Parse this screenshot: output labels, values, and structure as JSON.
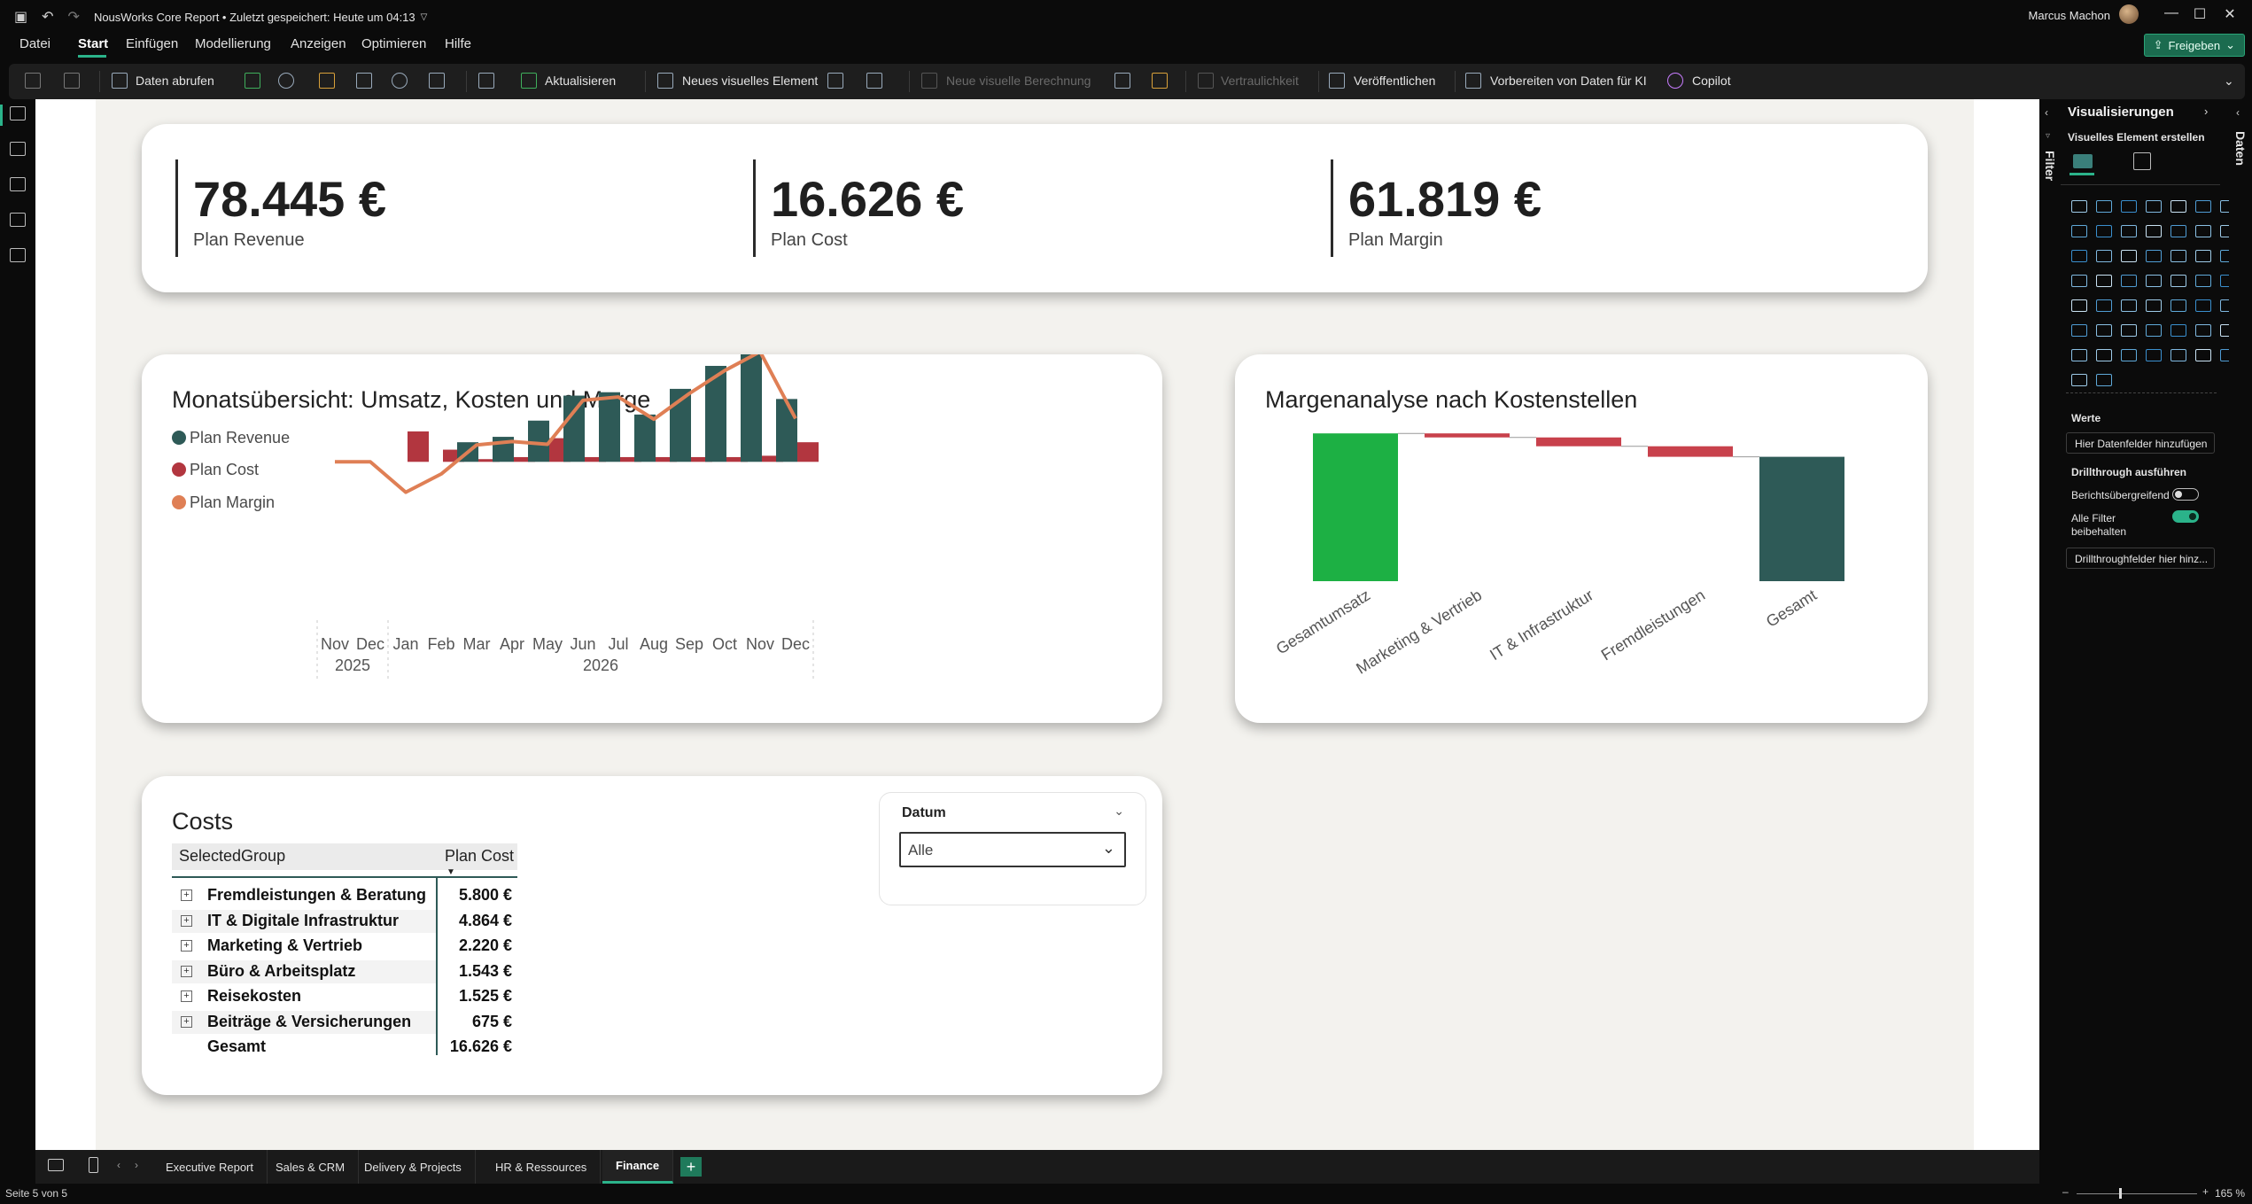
{
  "app": {
    "title": "NousWorks Core Report • Zuletzt gespeichert: Heute um 04:13",
    "user": "Marcus Machon",
    "share_label": "Freigeben"
  },
  "menu": {
    "items": [
      "Datei",
      "Start",
      "Einfügen",
      "Modellierung",
      "Anzeigen",
      "Optimieren",
      "Hilfe"
    ],
    "active": "Start"
  },
  "ribbon": {
    "get_data": "Daten abrufen",
    "refresh": "Aktualisieren",
    "new_visual": "Neues visuelles Element",
    "new_calc": "Neue visuelle Berechnung",
    "sensitivity": "Vertraulichkeit",
    "publish": "Veröffentlichen",
    "prepare_ai": "Vorbereiten von Daten für KI",
    "copilot": "Copilot"
  },
  "kpis": [
    {
      "value": "78.445 €",
      "label": "Plan Revenue"
    },
    {
      "value": "16.626 €",
      "label": "Plan Cost"
    },
    {
      "value": "61.819 €",
      "label": "Plan Margin"
    }
  ],
  "monthly": {
    "title": "Monatsübersicht: Umsatz, Kosten und Marge",
    "legend": [
      "Plan Revenue",
      "Plan Cost",
      "Plan Margin"
    ]
  },
  "waterfall": {
    "title": "Margenanalyse nach Kostenstellen"
  },
  "chart_data": [
    {
      "type": "bar",
      "title": "Monatsübersicht: Umsatz, Kosten und Marge",
      "categories": [
        "Nov",
        "Dec",
        "Jan",
        "Feb",
        "Mar",
        "Apr",
        "May",
        "Jun",
        "Jul",
        "Aug",
        "Sep",
        "Oct",
        "Nov",
        "Dec"
      ],
      "year_groups": [
        {
          "label": "2025",
          "span": 2
        },
        {
          "label": "2026",
          "span": 12
        }
      ],
      "series": [
        {
          "name": "Plan Revenue",
          "color": "#2e5a57",
          "values": [
            0,
            0,
            0,
            0,
            1450,
            1850,
            3050,
            4900,
            5150,
            3500,
            5400,
            7100,
            8600,
            4650
          ]
        },
        {
          "name": "Plan Cost",
          "color": "#b2363f",
          "values": [
            0,
            0,
            2250,
            900,
            200,
            350,
            1750,
            350,
            350,
            350,
            350,
            350,
            450,
            1450
          ]
        },
        {
          "name": "Plan Margin",
          "color": "#df7f55",
          "values": [
            0,
            0,
            -2250,
            -900,
            1250,
            1500,
            1300,
            4550,
            4800,
            3150,
            5050,
            6750,
            8150,
            3200
          ]
        }
      ],
      "ylim": [
        -2800,
        9000
      ]
    },
    {
      "type": "waterfall",
      "title": "Margenanalyse nach Kostenstellen",
      "categories": [
        "Gesamtumsatz",
        "Marketing & Vertrieb",
        "IT & Infrastruktur",
        "Fremdleistungen",
        "Gesamt"
      ],
      "values": [
        78445,
        -2220,
        -4864,
        -5800,
        65561
      ],
      "colors": {
        "increase": "#1db044",
        "decrease": "#c8414c",
        "total": "#2e5a57"
      },
      "ylim": [
        0,
        80000
      ]
    }
  ],
  "costs": {
    "title": "Costs",
    "col_group": "SelectedGroup",
    "col_cost": "Plan Cost",
    "rows": [
      {
        "label": "Fremdleistungen & Beratung",
        "value": "5.800 €"
      },
      {
        "label": "IT & Digitale Infrastruktur",
        "value": "4.864 €"
      },
      {
        "label": "Marketing & Vertrieb",
        "value": "2.220 €"
      },
      {
        "label": "Büro & Arbeitsplatz",
        "value": "1.543 €"
      },
      {
        "label": "Reisekosten",
        "value": "1.525 €"
      },
      {
        "label": "Beiträge & Versicherungen",
        "value": "675 €"
      }
    ],
    "total_label": "Gesamt",
    "total_value": "16.626 €"
  },
  "slicer": {
    "title": "Datum",
    "value": "Alle"
  },
  "viz_pane": {
    "title": "Visualisierungen",
    "subtitle": "Visuelles Element erstellen",
    "values_label": "Werte",
    "values_box": "Hier Datenfelder hinzufügen",
    "drill_label": "Drillthrough ausführen",
    "cross_report": "Berichtsübergreifend",
    "keep_filters": "Alle Filter beibehalten",
    "drill_box": "Drillthroughfelder hier hinz...",
    "filter_label": "Filter",
    "data_label": "Daten"
  },
  "tabs": [
    "Executive Report",
    "Sales & CRM",
    "Delivery & Projects",
    "HR & Ressources",
    "Finance"
  ],
  "active_tab": "Finance",
  "status": {
    "page": "Seite 5 von 5",
    "zoom": "165 %"
  }
}
